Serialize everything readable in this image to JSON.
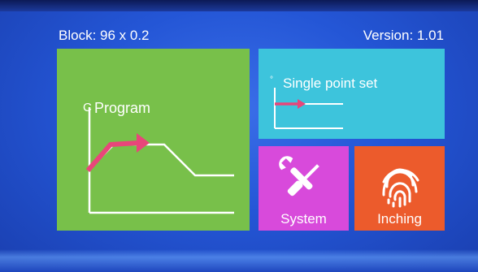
{
  "header": {
    "block_label": "Block:  96 x 0.2",
    "version_label": "Version:  1.01"
  },
  "tiles": {
    "program": {
      "label": "Program",
      "axis_label": "C"
    },
    "single_point": {
      "label": "Single point set",
      "axis_label": "°"
    },
    "system": {
      "label": "System",
      "icon": "tools-icon"
    },
    "inching": {
      "label": "Inching",
      "icon": "fingerprint-icon"
    }
  },
  "colors": {
    "program_tile": "#78c04a",
    "single_point_tile": "#3dc4dc",
    "system_tile": "#d84adb",
    "inching_tile": "#ec5b2c",
    "accent_arrow": "#e8467a"
  }
}
